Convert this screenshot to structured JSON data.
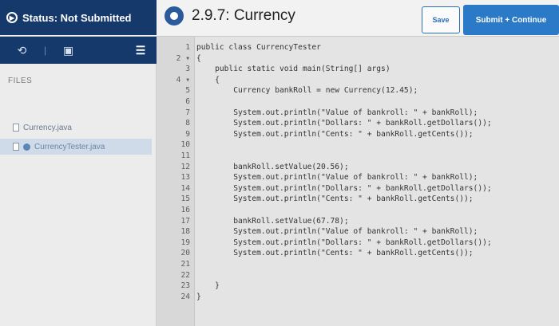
{
  "header": {
    "status_text": "Status: Not Submitted",
    "title": "2.9.7: Currency",
    "save_label": "Save",
    "submit_label": "Submit + Continue"
  },
  "sidebar": {
    "files_label": "FILES",
    "files": [
      {
        "name": "Currency.java",
        "selected": false
      },
      {
        "name": "CurrencyTester.java",
        "selected": true
      }
    ]
  },
  "editor": {
    "lines": [
      {
        "n": "1",
        "text": "public class CurrencyTester"
      },
      {
        "n": "2 ▾",
        "text": "{"
      },
      {
        "n": "3",
        "text": "    public static void main(String[] args)"
      },
      {
        "n": "4 ▾",
        "text": "    {"
      },
      {
        "n": "5",
        "text": "        Currency bankRoll = new Currency(12.45);"
      },
      {
        "n": "6",
        "text": ""
      },
      {
        "n": "7",
        "text": "        System.out.println(\"Value of bankroll: \" + bankRoll);"
      },
      {
        "n": "8",
        "text": "        System.out.println(\"Dollars: \" + bankRoll.getDollars());"
      },
      {
        "n": "9",
        "text": "        System.out.println(\"Cents: \" + bankRoll.getCents());"
      },
      {
        "n": "10",
        "text": ""
      },
      {
        "n": "11",
        "text": ""
      },
      {
        "n": "12",
        "text": "        bankRoll.setValue(20.56);"
      },
      {
        "n": "13",
        "text": "        System.out.println(\"Value of bankroll: \" + bankRoll);"
      },
      {
        "n": "14",
        "text": "        System.out.println(\"Dollars: \" + bankRoll.getDollars());"
      },
      {
        "n": "15",
        "text": "        System.out.println(\"Cents: \" + bankRoll.getCents());"
      },
      {
        "n": "16",
        "text": ""
      },
      {
        "n": "17",
        "text": "        bankRoll.setValue(67.78);"
      },
      {
        "n": "18",
        "text": "        System.out.println(\"Value of bankroll: \" + bankRoll);"
      },
      {
        "n": "19",
        "text": "        System.out.println(\"Dollars: \" + bankRoll.getDollars());"
      },
      {
        "n": "20",
        "text": "        System.out.println(\"Cents: \" + bankRoll.getCents());"
      },
      {
        "n": "21",
        "text": ""
      },
      {
        "n": "22",
        "text": ""
      },
      {
        "n": "23",
        "text": "    }"
      },
      {
        "n": "24",
        "text": "}"
      }
    ]
  }
}
